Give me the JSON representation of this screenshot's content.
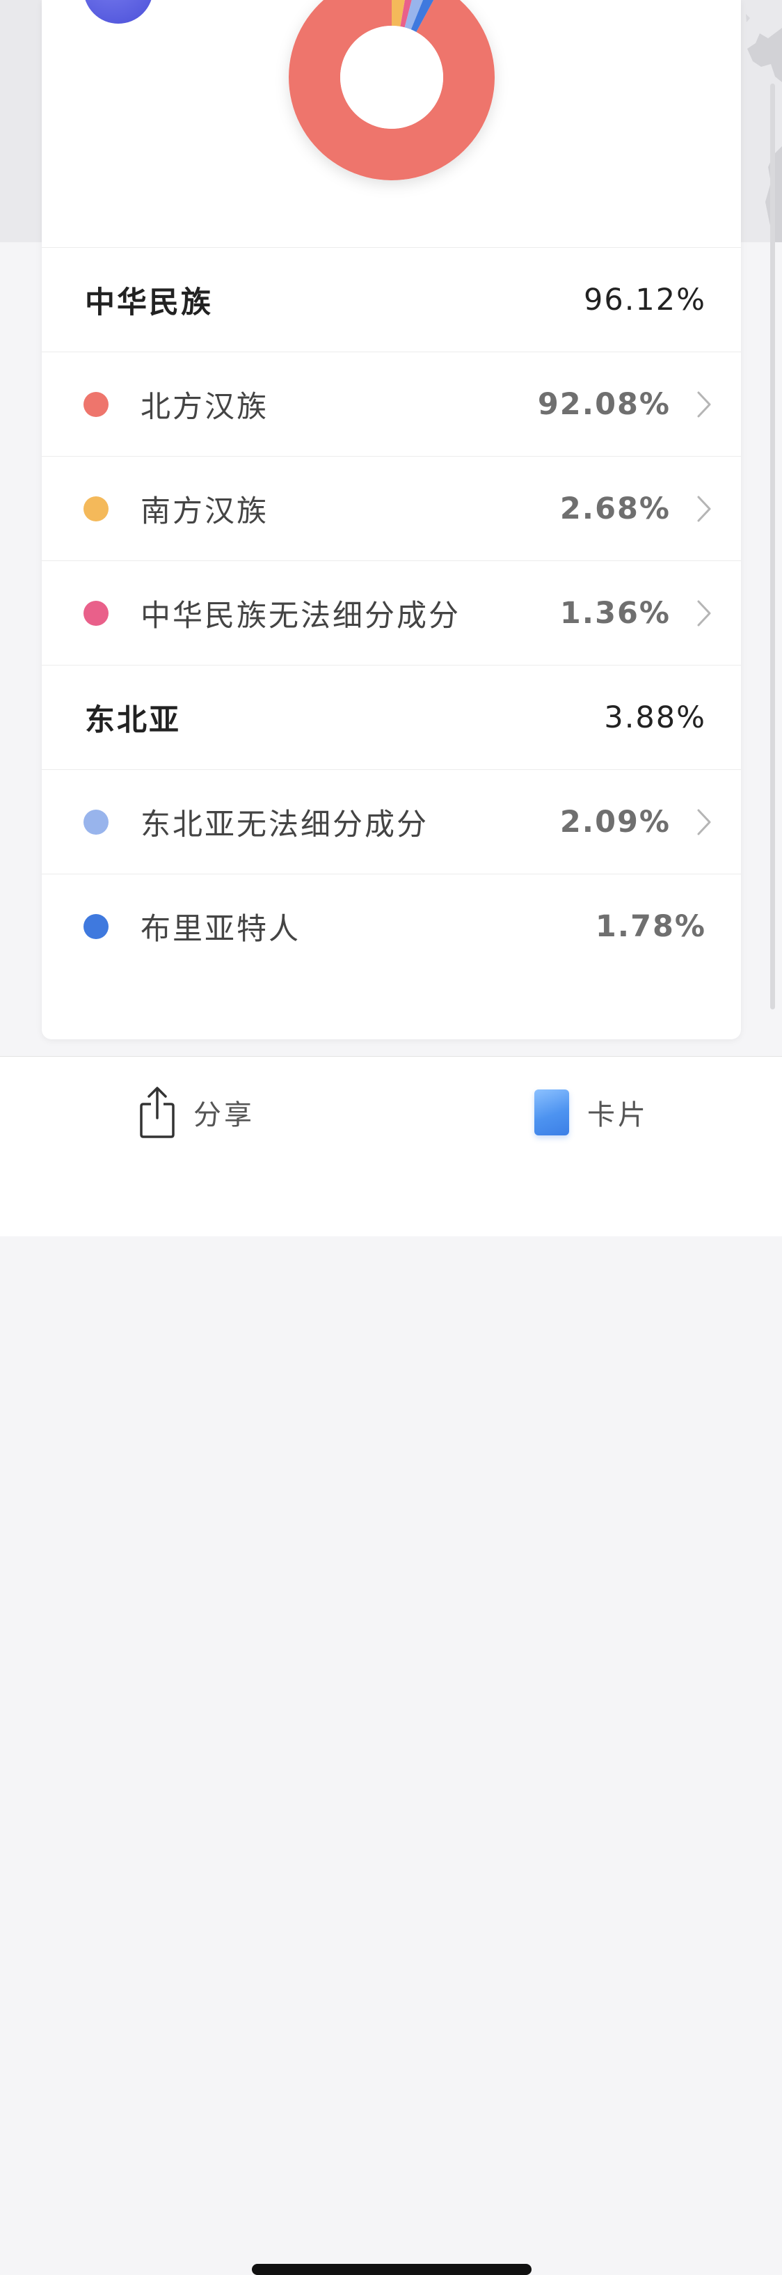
{
  "colors": {
    "northern_han": "#ee756c",
    "southern_han": "#f4b95a",
    "chinese_undetermined": "#e9608a",
    "northeast_asia_undetermined": "#98b4ec",
    "buryat": "#3f79de"
  },
  "chart_data": {
    "type": "pie",
    "subtype": "donut",
    "title": "",
    "categories": [
      "北方汉族",
      "南方汉族",
      "中华民族无法细分成分",
      "东北亚无法细分成分",
      "布里亚特人"
    ],
    "values": [
      92.08,
      2.68,
      1.36,
      2.09,
      1.78
    ],
    "unit": "%",
    "colors": [
      "#ee756c",
      "#f4b95a",
      "#e9608a",
      "#98b4ec",
      "#3f79de"
    ]
  },
  "breakdown": [
    {
      "kind": "group",
      "name": "中华民族",
      "percent": "96.12%"
    },
    {
      "kind": "sub",
      "name": "北方汉族",
      "percent": "92.08%",
      "color": "#ee756c",
      "chevron": true
    },
    {
      "kind": "sub",
      "name": "南方汉族",
      "percent": "2.68%",
      "color": "#f4b95a",
      "chevron": true
    },
    {
      "kind": "sub",
      "name": "中华民族无法细分成分",
      "percent": "1.36%",
      "color": "#e9608a",
      "chevron": true
    },
    {
      "kind": "group",
      "name": "东北亚",
      "percent": "3.88%"
    },
    {
      "kind": "sub",
      "name": "东北亚无法细分成分",
      "percent": "2.09%",
      "color": "#98b4ec",
      "chevron": true
    },
    {
      "kind": "sub",
      "name": "布里亚特人",
      "percent": "1.78%",
      "color": "#3f79de",
      "chevron": false
    }
  ],
  "bottom_bar": {
    "share_label": "分享",
    "share_icon": "share-icon",
    "card_label": "卡片",
    "card_icon": "card-icon"
  }
}
